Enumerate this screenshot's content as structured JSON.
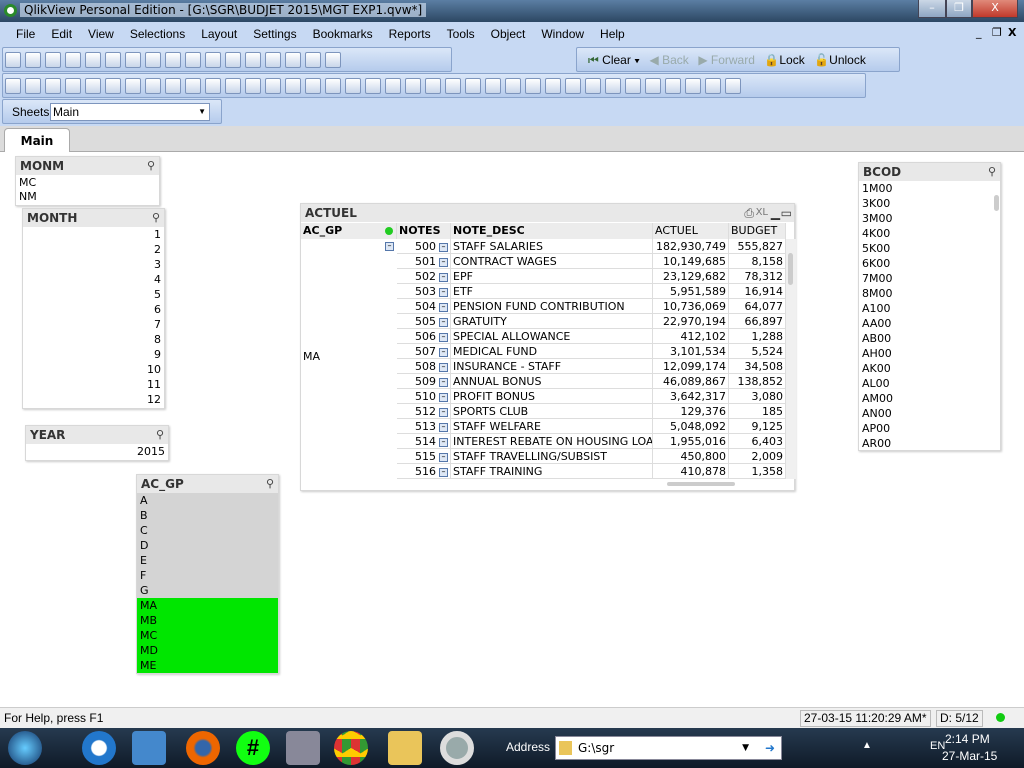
{
  "window": {
    "title": "QlikView Personal Edition - [G:\\SGR\\BUDJET 2015\\MGT EXP1.qvw*]",
    "min": "–",
    "restore": "❐",
    "close": "X"
  },
  "menu": [
    "File",
    "Edit",
    "View",
    "Selections",
    "Layout",
    "Settings",
    "Bookmarks",
    "Reports",
    "Tools",
    "Object",
    "Window",
    "Help"
  ],
  "mdi": {
    "min": "_",
    "restore": "❐",
    "close": "X"
  },
  "nav": {
    "clear": "Clear",
    "back": "Back",
    "forward": "Forward",
    "lock": "Lock",
    "unlock": "Unlock"
  },
  "sheets": {
    "label": "Sheets",
    "selected": "Main"
  },
  "tabs": [
    {
      "label": "Main"
    }
  ],
  "monm": {
    "title": "MONM",
    "items": [
      "MC",
      "NM"
    ]
  },
  "month": {
    "title": "MONTH",
    "items": [
      "1",
      "2",
      "3",
      "4",
      "5",
      "6",
      "7",
      "8",
      "9",
      "10",
      "11",
      "12"
    ]
  },
  "year": {
    "title": "YEAR",
    "items": [
      "2015"
    ]
  },
  "acgp": {
    "title": "AC_GP",
    "items": [
      {
        "v": "A",
        "s": "gray"
      },
      {
        "v": "B",
        "s": "gray"
      },
      {
        "v": "C",
        "s": "gray"
      },
      {
        "v": "D",
        "s": "gray"
      },
      {
        "v": "E",
        "s": "gray"
      },
      {
        "v": "F",
        "s": "gray"
      },
      {
        "v": "G",
        "s": "gray"
      },
      {
        "v": "MA",
        "s": "green"
      },
      {
        "v": "MB",
        "s": "green"
      },
      {
        "v": "MC",
        "s": "green"
      },
      {
        "v": "MD",
        "s": "green"
      },
      {
        "v": "ME",
        "s": "green"
      }
    ]
  },
  "bcod": {
    "title": "BCOD",
    "items": [
      "1M00",
      "3K00",
      "3M00",
      "4K00",
      "5K00",
      "6K00",
      "7M00",
      "8M00",
      "A100",
      "AA00",
      "AB00",
      "AH00",
      "AK00",
      "AL00",
      "AM00",
      "AN00",
      "AP00",
      "AR00"
    ]
  },
  "table": {
    "title": "ACTUEL",
    "xl": "XL",
    "columns": [
      "AC_GP",
      "NOTES",
      "NOTE_DESC",
      "ACTUEL",
      "BUDGET"
    ],
    "group": "MA",
    "rows": [
      [
        "500",
        "STAFF SALARIES",
        "182,930,749",
        "555,827"
      ],
      [
        "501",
        "CONTRACT WAGES",
        "10,149,685",
        "8,158"
      ],
      [
        "502",
        "EPF",
        "23,129,682",
        "78,312"
      ],
      [
        "503",
        "ETF",
        "5,951,589",
        "16,914"
      ],
      [
        "504",
        "PENSION FUND CONTRIBUTION",
        "10,736,069",
        "64,077"
      ],
      [
        "505",
        "GRATUITY",
        "22,970,194",
        "66,897"
      ],
      [
        "506",
        "SPECIAL ALLOWANCE",
        "412,102",
        "1,288"
      ],
      [
        "507",
        "MEDICAL FUND",
        "3,101,534",
        "5,524"
      ],
      [
        "508",
        "INSURANCE - STAFF",
        "12,099,174",
        "34,508"
      ],
      [
        "509",
        "ANNUAL BONUS",
        "46,089,867",
        "138,852"
      ],
      [
        "510",
        "PROFIT BONUS",
        "3,642,317",
        "3,080"
      ],
      [
        "512",
        "SPORTS CLUB",
        "129,376",
        "185"
      ],
      [
        "513",
        "STAFF WELFARE",
        "5,048,092",
        "9,125"
      ],
      [
        "514",
        "INTEREST REBATE ON HOUSING LOANS",
        "1,955,016",
        "6,403"
      ],
      [
        "515",
        "STAFF TRAVELLING/SUBSIST",
        "450,800",
        "2,009"
      ],
      [
        "516",
        "STAFF TRAINING",
        "410,878",
        "1,358"
      ]
    ]
  },
  "status": {
    "help": "For Help, press F1",
    "timestamp": "27-03-15 11:20:29 AM*",
    "doc": "D: 5/12"
  },
  "taskbar": {
    "address_label": "Address",
    "address_value": "G:\\sgr",
    "lang": "EN",
    "time": "2:14 PM",
    "date": "27-Mar-15"
  },
  "colors": {
    "selected": "#00e600",
    "excluded": "#d4d4d4"
  }
}
